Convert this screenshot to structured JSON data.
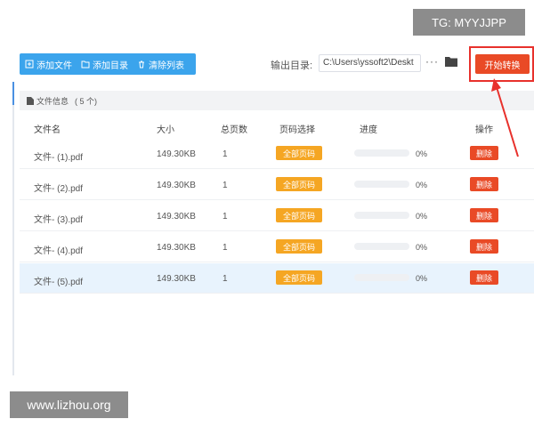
{
  "toolbar": {
    "add_file": "添加文件",
    "add_dir": "添加目录",
    "clear_list": "清除列表"
  },
  "output": {
    "label": "输出目录:",
    "path": "C:\\Users\\yssoft2\\Deskt",
    "more": "···"
  },
  "start_button": "开始转换",
  "file_info": {
    "label": "文件信息",
    "count": "( 5 个)"
  },
  "table": {
    "headers": {
      "name": "文件名",
      "size": "大小",
      "pages": "总页数",
      "page_select": "页码选择",
      "progress": "进度",
      "action": "操作"
    },
    "rows": [
      {
        "name": "文件- (1).pdf",
        "size": "149.30KB",
        "pages": "1",
        "page_select": "全部页码",
        "progress": 0,
        "percent": "0%",
        "action": "删除"
      },
      {
        "name": "文件- (2).pdf",
        "size": "149.30KB",
        "pages": "1",
        "page_select": "全部页码",
        "progress": 0,
        "percent": "0%",
        "action": "删除"
      },
      {
        "name": "文件- (3).pdf",
        "size": "149.30KB",
        "pages": "1",
        "page_select": "全部页码",
        "progress": 0,
        "percent": "0%",
        "action": "删除"
      },
      {
        "name": "文件- (4).pdf",
        "size": "149.30KB",
        "pages": "1",
        "page_select": "全部页码",
        "progress": 0,
        "percent": "0%",
        "action": "删除"
      },
      {
        "name": "文件- (5).pdf",
        "size": "149.30KB",
        "pages": "1",
        "page_select": "全部页码",
        "progress": 0,
        "percent": "0%",
        "action": "删除"
      }
    ]
  },
  "watermarks": {
    "top": "TG: MYYJJPP",
    "bottom": "www.lizhou.org"
  },
  "colors": {
    "toolbar": "#3ba4ec",
    "start": "#e94a26",
    "highlight": "#e8312c",
    "page_button": "#f5a623",
    "delete": "#e94a26"
  }
}
